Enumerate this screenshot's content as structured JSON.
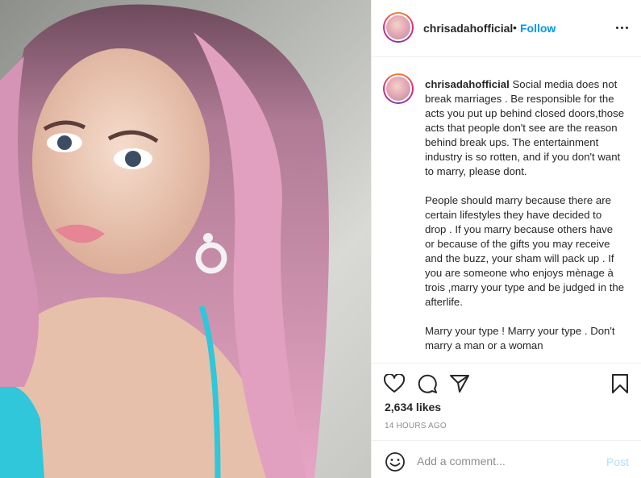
{
  "post": {
    "username": "chrisadahofficial",
    "separator": "•",
    "follow_label": "Follow",
    "more_icon": "more-horizontal-icon",
    "caption_paragraphs": [
      "Social media does not break marriages . Be responsible for the acts you put up behind closed doors,those acts that people don't see are the reason behind break ups. The entertainment industry is so rotten, and if you don't want to marry, please dont.",
      "People should marry because there are certain lifestyles they have decided to drop . If you marry because others have or because of the gifts you may receive and the buzz, your sham will pack up . If you are someone who enjoys mènage à trois ,marry your type and be judged in the afterlife.",
      "Marry your type ! Marry your type . Don't marry a man or a woman"
    ],
    "likes": "2,634 likes",
    "timestamp": "14 HOURS AGO"
  },
  "comment": {
    "placeholder": "Add a comment...",
    "post_label": "Post"
  },
  "icons": {
    "like": "heart-icon",
    "comment": "comment-icon",
    "share": "share-icon",
    "save": "bookmark-icon",
    "emoji": "emoji-icon"
  },
  "colors": {
    "follow": "#0095f6",
    "post_disabled": "#b2dffc",
    "secondary_text": "#8e8e8e",
    "border": "#efefef"
  }
}
